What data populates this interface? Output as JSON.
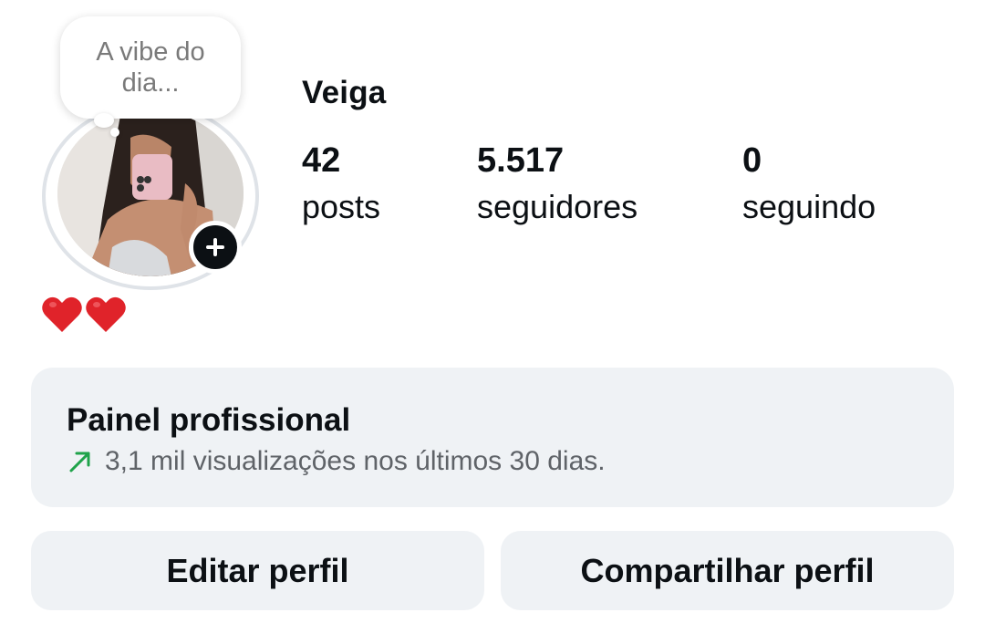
{
  "profile": {
    "username": "Veiga",
    "note": "A vibe do dia...",
    "bio_emojis": [
      "❤️",
      "❤️"
    ]
  },
  "stats": {
    "posts": {
      "value": "42",
      "label": "posts"
    },
    "followers": {
      "value": "5.517",
      "label": "seguidores"
    },
    "following": {
      "value": "0",
      "label": "seguindo"
    }
  },
  "pro_panel": {
    "title": "Painel profissional",
    "subtitle": "3,1 mil visualizações nos últimos 30 dias.",
    "trend_icon": "trend-up-arrow-icon",
    "trend_color": "#1fa34a"
  },
  "buttons": {
    "edit": "Editar perfil",
    "share": "Compartilhar perfil"
  },
  "colors": {
    "heart": "#e0232a",
    "panel_bg": "#eff2f5",
    "badge_bg": "#0c1014"
  }
}
